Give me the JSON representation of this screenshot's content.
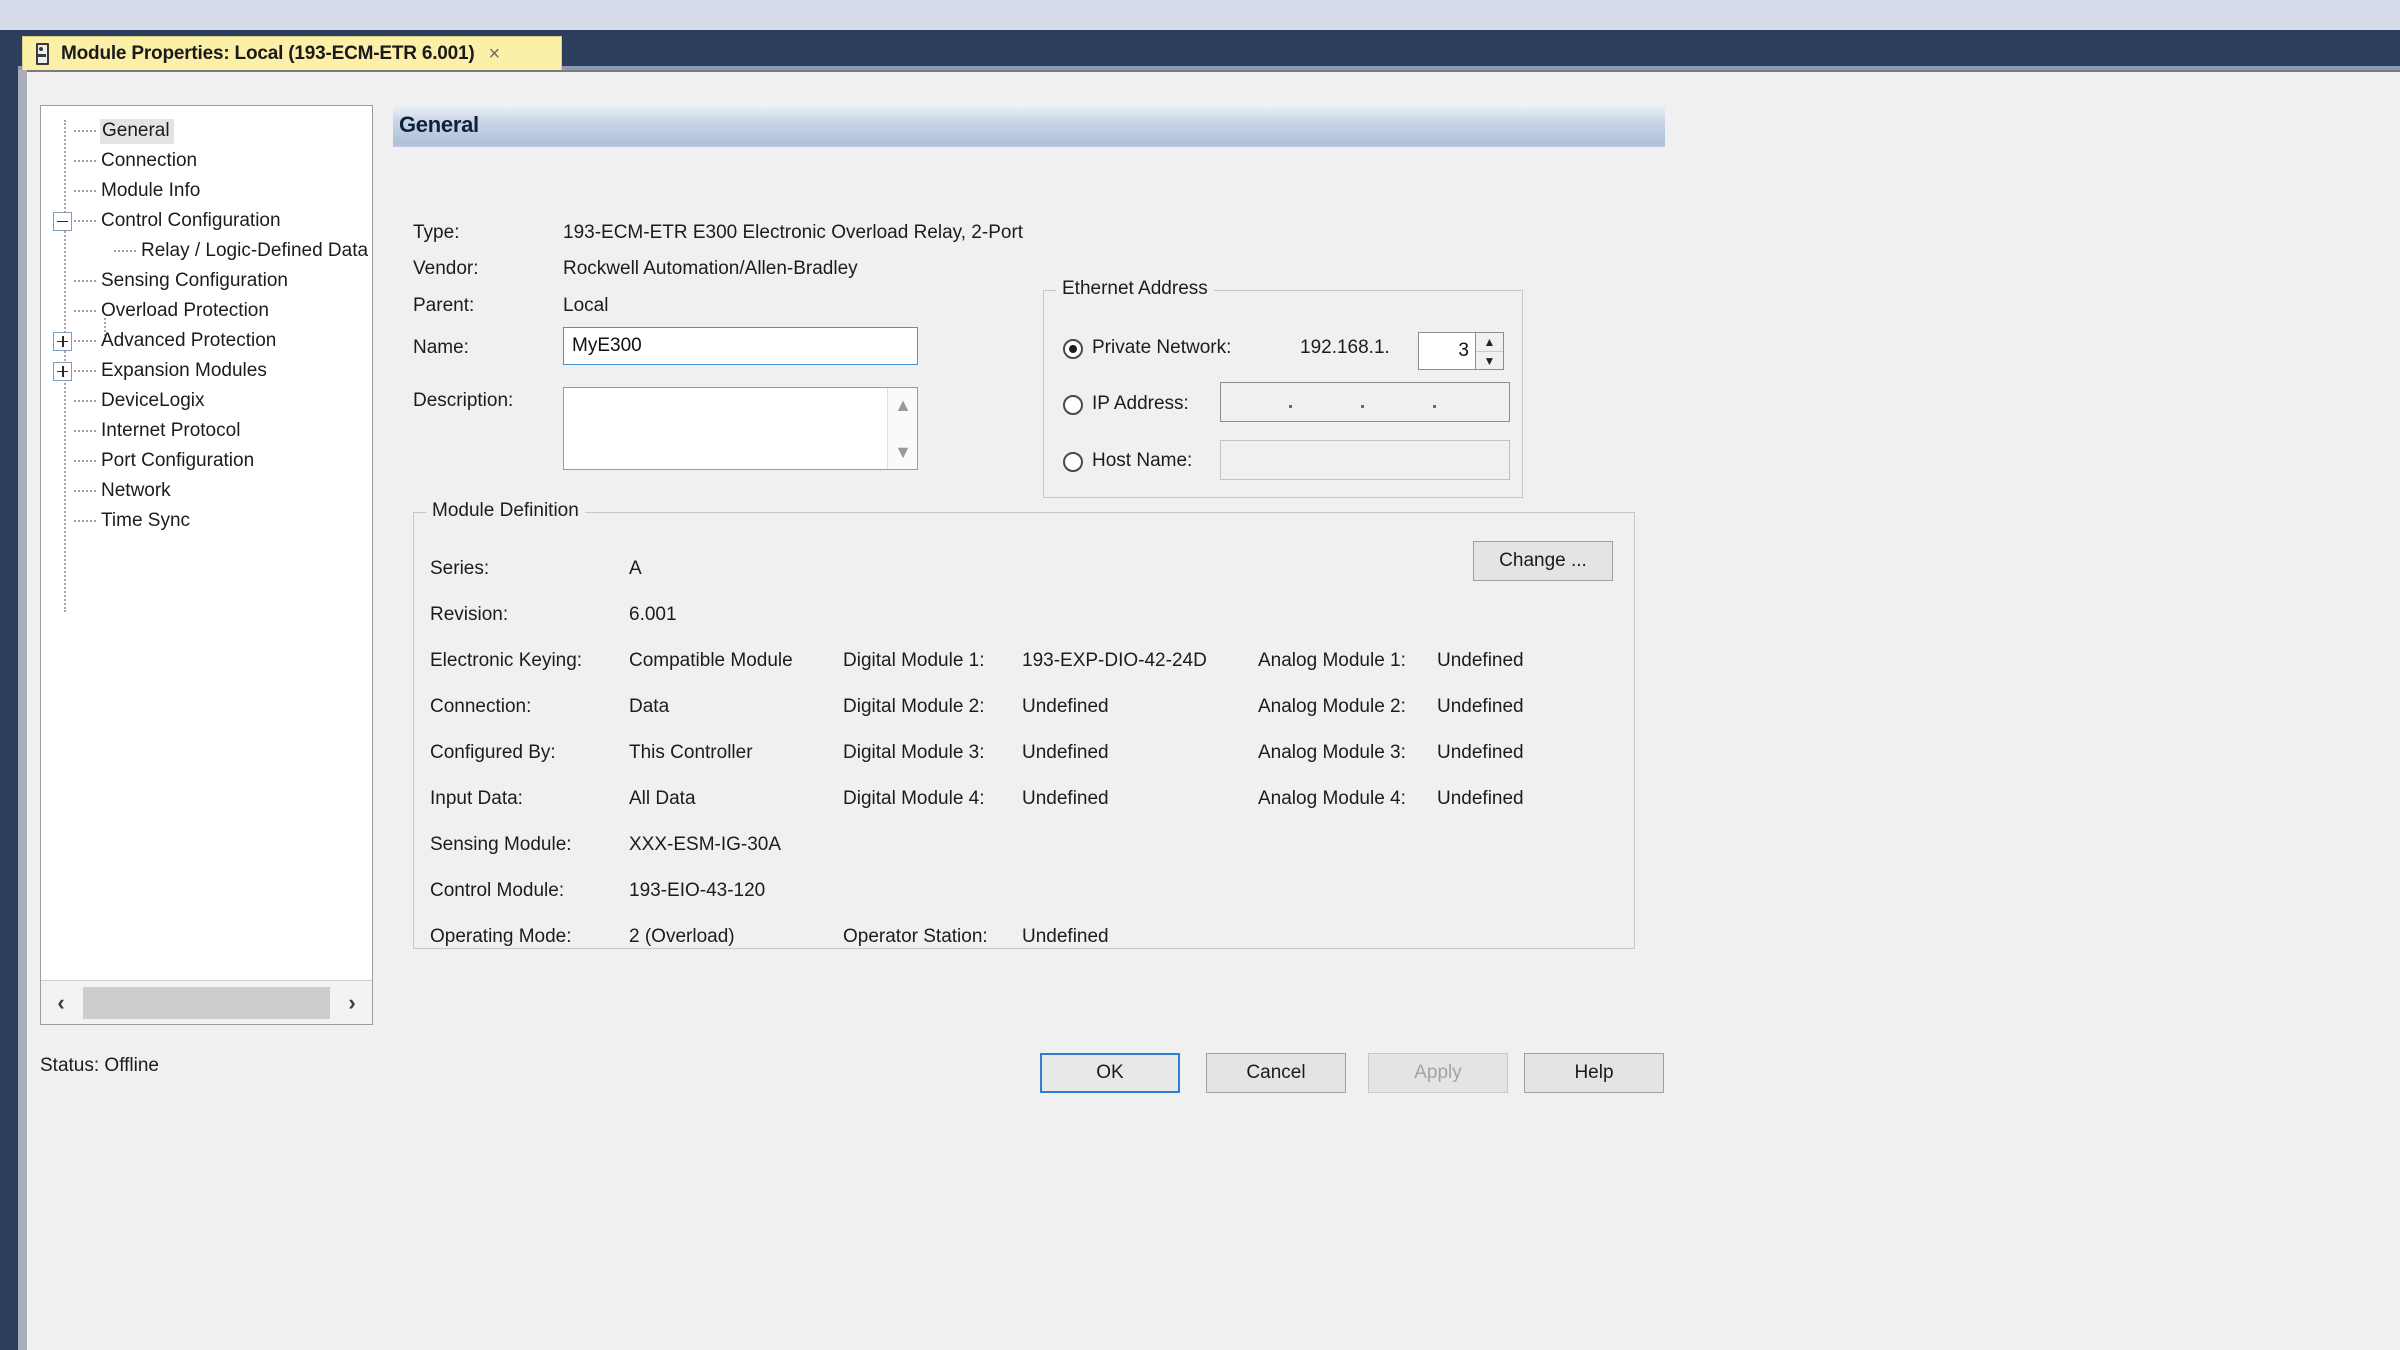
{
  "window": {
    "tab_title": "Module Properties: Local (193-ECM-ETR 6.001)",
    "tab_icon": "module-icon",
    "close_icon": "×"
  },
  "tree": {
    "items": [
      {
        "label": "General",
        "level": 0,
        "toggle": "none",
        "selected": true
      },
      {
        "label": "Connection",
        "level": 0,
        "toggle": "none",
        "selected": false
      },
      {
        "label": "Module Info",
        "level": 0,
        "toggle": "none",
        "selected": false
      },
      {
        "label": "Control Configuration",
        "level": 0,
        "toggle": "minus",
        "selected": false
      },
      {
        "label": "Relay / Logic-Defined Data",
        "level": 1,
        "toggle": "none",
        "selected": false
      },
      {
        "label": "Sensing Configuration",
        "level": 0,
        "toggle": "none",
        "selected": false
      },
      {
        "label": "Overload Protection",
        "level": 0,
        "toggle": "none",
        "selected": false
      },
      {
        "label": "Advanced Protection",
        "level": 0,
        "toggle": "plus",
        "selected": false
      },
      {
        "label": "Expansion Modules",
        "level": 0,
        "toggle": "plus",
        "selected": false
      },
      {
        "label": "DeviceLogix",
        "level": 0,
        "toggle": "none",
        "selected": false
      },
      {
        "label": "Internet Protocol",
        "level": 0,
        "toggle": "none",
        "selected": false
      },
      {
        "label": "Port Configuration",
        "level": 0,
        "toggle": "none",
        "selected": false
      },
      {
        "label": "Network",
        "level": 0,
        "toggle": "none",
        "selected": false
      },
      {
        "label": "Time Sync",
        "level": 0,
        "toggle": "none",
        "selected": false
      }
    ],
    "scroll_left_icon": "‹",
    "scroll_right_icon": "›"
  },
  "page": {
    "header_title": "General"
  },
  "general": {
    "type_label": "Type:",
    "type_value": "193-ECM-ETR E300 Electronic Overload Relay, 2-Port",
    "vendor_label": "Vendor:",
    "vendor_value": "Rockwell Automation/Allen-Bradley",
    "parent_label": "Parent:",
    "parent_value": "Local",
    "name_label": "Name:",
    "name_value": "MyE300",
    "description_label": "Description:",
    "description_value": ""
  },
  "ethernet": {
    "group_title": "Ethernet Address",
    "private_network_label": "Private Network:",
    "private_network_prefix": "192.168.1.",
    "private_network_octet": "3",
    "private_network_selected": true,
    "ip_address_label": "IP Address:",
    "ip_address_value": "",
    "ip_address_selected": false,
    "host_name_label": "Host Name:",
    "host_name_value": "",
    "host_name_selected": false,
    "spin_up_icon": "▲",
    "spin_down_icon": "▼"
  },
  "module_definition": {
    "group_title": "Module Definition",
    "change_button": "Change ...",
    "col1": [
      {
        "label": "Series:",
        "value": "A"
      },
      {
        "label": "Revision:",
        "value": "6.001"
      },
      {
        "label": "Electronic Keying:",
        "value": "Compatible Module"
      },
      {
        "label": "Connection:",
        "value": "Data"
      },
      {
        "label": "Configured By:",
        "value": "This Controller"
      },
      {
        "label": "Input Data:",
        "value": "All Data"
      },
      {
        "label": "Sensing Module:",
        "value": "XXX-ESM-IG-30A"
      },
      {
        "label": "Control Module:",
        "value": "193-EIO-43-120"
      },
      {
        "label": "Operating Mode:",
        "value": "2 (Overload)"
      }
    ],
    "col2": [
      {
        "label": "Digital Module 1:",
        "value": "193-EXP-DIO-42-24D"
      },
      {
        "label": "Digital Module 2:",
        "value": "Undefined"
      },
      {
        "label": "Digital Module 3:",
        "value": "Undefined"
      },
      {
        "label": "Digital Module 4:",
        "value": "Undefined"
      },
      {
        "label": "Operator Station:",
        "value": "Undefined"
      }
    ],
    "col3": [
      {
        "label": "Analog Module 1:",
        "value": "Undefined"
      },
      {
        "label": "Analog Module 2:",
        "value": "Undefined"
      },
      {
        "label": "Analog Module 3:",
        "value": "Undefined"
      },
      {
        "label": "Analog Module 4:",
        "value": "Undefined"
      }
    ]
  },
  "footer": {
    "status_label": "Status:",
    "status_value": "Offline",
    "status_text": "Status:  Offline",
    "ok": "OK",
    "cancel": "Cancel",
    "apply": "Apply",
    "help": "Help"
  },
  "colors": {
    "tab_bg": "#fcf0a8",
    "titlebar": "#2b3e5e",
    "panel_bg": "#f0f0f0",
    "accent_focus": "#2d7dd2",
    "header_gradient_end": "#aec0d8"
  }
}
